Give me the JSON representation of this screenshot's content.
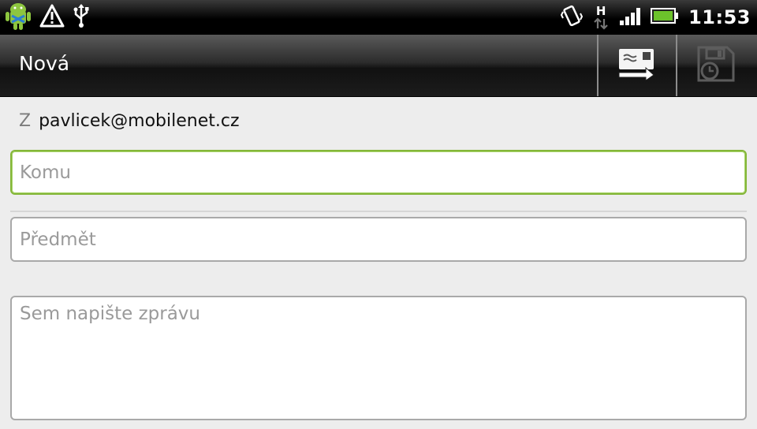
{
  "statusbar": {
    "time": "11:53",
    "network_type": "H",
    "icons": [
      "android-debug-icon",
      "warning-icon",
      "usb-icon",
      "vibrate-icon",
      "data-arrows-icon",
      "signal-icon",
      "battery-icon"
    ]
  },
  "actionbar": {
    "title": "Nová",
    "send_icon": "send-icon",
    "save_icon": "save-draft-icon"
  },
  "form": {
    "from_label": "Z",
    "from_value": "pavlicek@mobilenet.cz",
    "to_placeholder": "Komu",
    "subject_placeholder": "Předmět",
    "body_placeholder": "Sem napište zprávu"
  },
  "colors": {
    "focus_border": "#84b638",
    "background": "#ededed"
  }
}
